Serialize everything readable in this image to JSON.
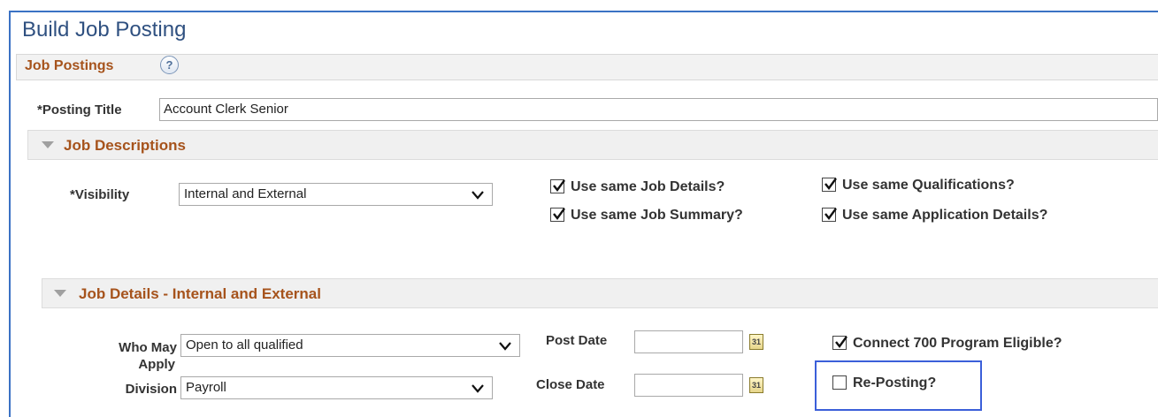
{
  "page": {
    "title": "Build Job Posting"
  },
  "header": {
    "title": "Job Postings",
    "help": "?"
  },
  "posting_title": {
    "label": "*Posting Title",
    "value": "Account Clerk Senior"
  },
  "job_descriptions": {
    "title": "Job Descriptions",
    "visibility_label": "*Visibility",
    "visibility_value": "Internal and External",
    "checks": {
      "job_details": {
        "label": "Use same Job Details?",
        "checked": true
      },
      "qualifications": {
        "label": "Use same Qualifications?",
        "checked": true
      },
      "job_summary": {
        "label": "Use same Job Summary?",
        "checked": true
      },
      "application_details": {
        "label": "Use same Application Details?",
        "checked": true
      }
    }
  },
  "job_details": {
    "title": "Job Details - Internal and External",
    "who_may_apply_label_1": "Who May",
    "who_may_apply_label_2": "Apply",
    "who_may_apply_value": "Open to all qualified",
    "division_label": "Division",
    "division_value": "Payroll",
    "post_date_label": "Post Date",
    "post_date_value": "",
    "close_date_label": "Close Date",
    "close_date_value": "",
    "calendar_glyph": "31",
    "connect700": {
      "label": "Connect 700 Program Eligible?",
      "checked": true
    },
    "reposting": {
      "label": "Re-Posting?",
      "checked": false
    }
  },
  "colors": {
    "accent_orange": "#a6531c",
    "frame_blue": "#3b72c4",
    "highlight_blue": "#3b5fd9",
    "title_blue": "#2f5080"
  }
}
